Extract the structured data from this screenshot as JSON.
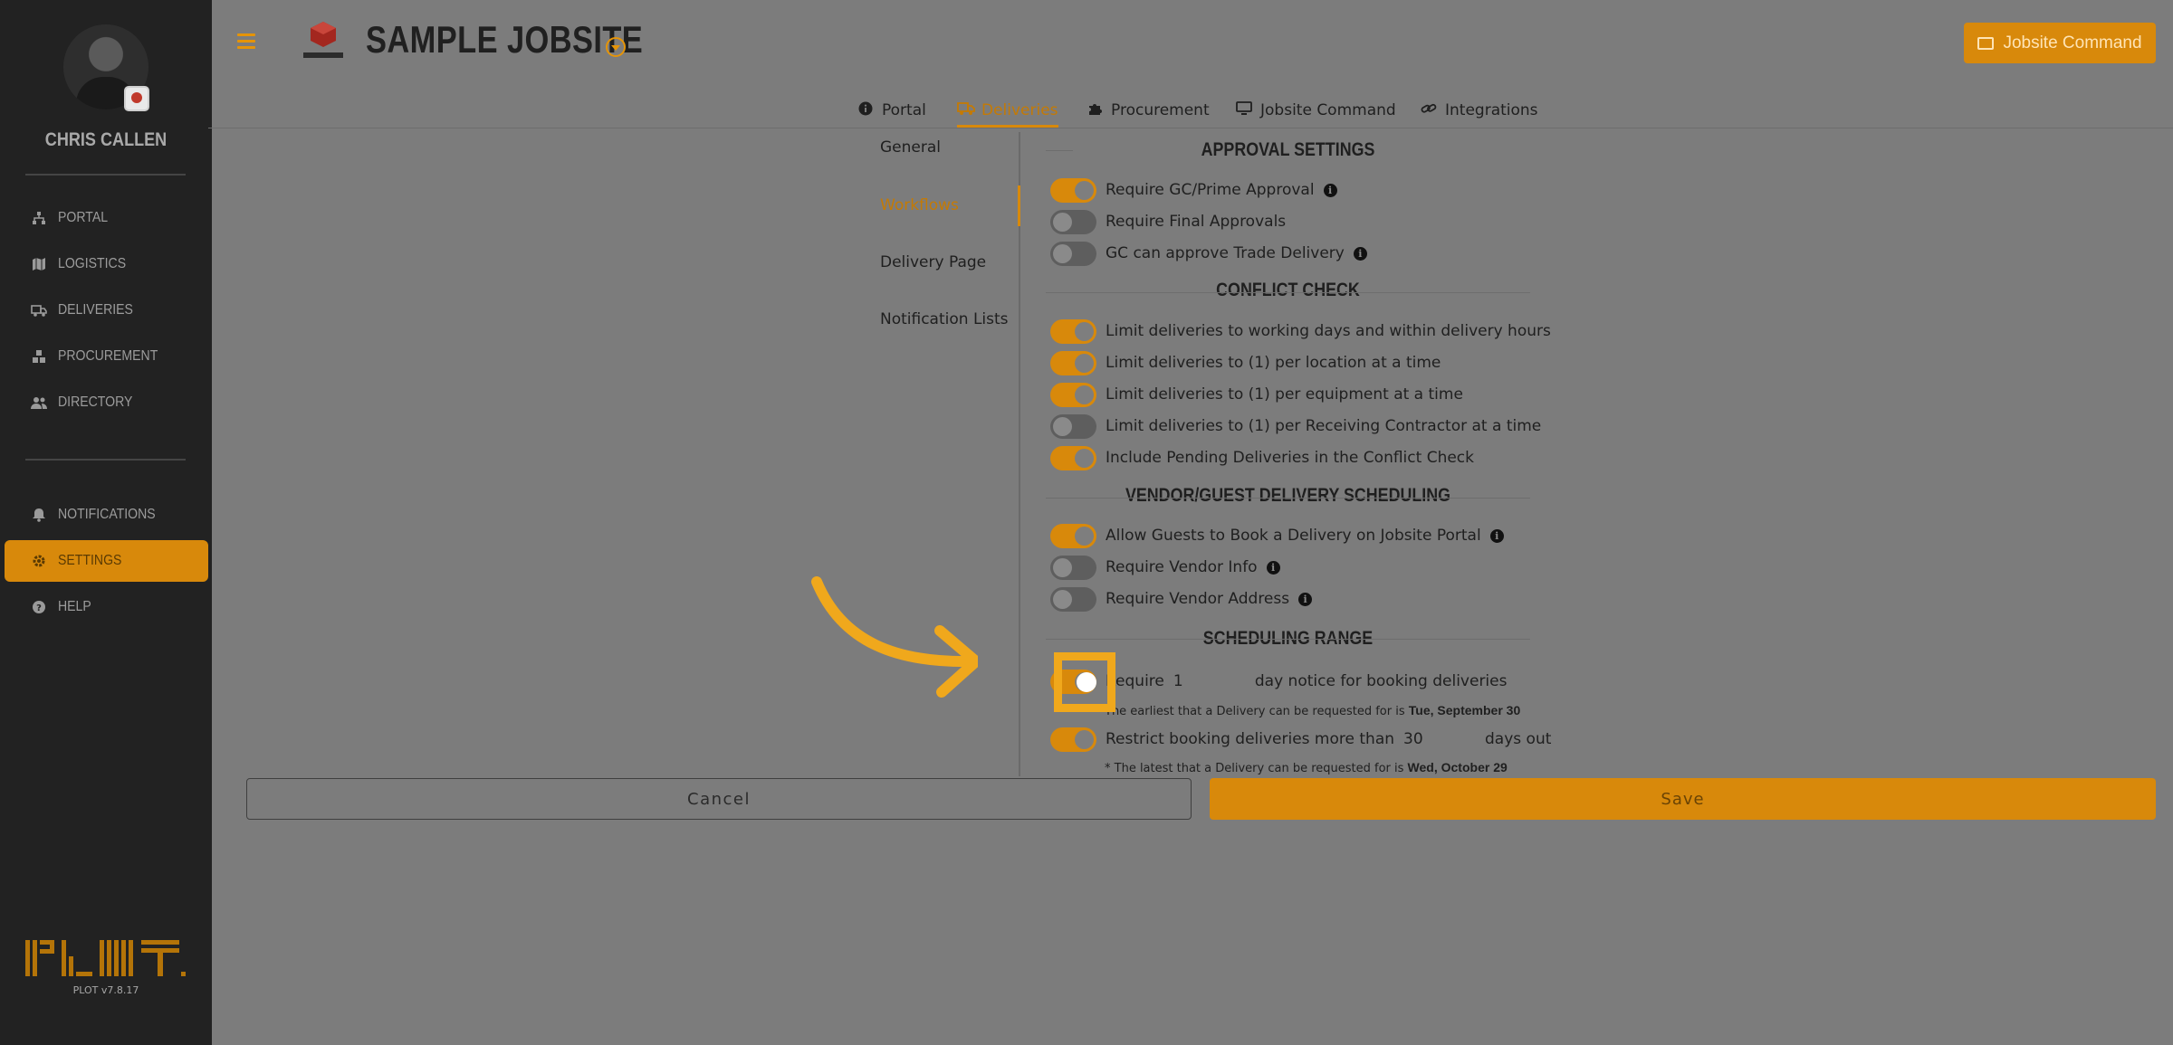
{
  "user": {
    "name": "CHRIS CALLEN"
  },
  "sidebar": {
    "items": [
      {
        "label": "PORTAL",
        "icon": "sitemap-icon"
      },
      {
        "label": "LOGISTICS",
        "icon": "map-icon"
      },
      {
        "label": "DELIVERIES",
        "icon": "truck-icon"
      },
      {
        "label": "PROCUREMENT",
        "icon": "cubes-icon"
      },
      {
        "label": "DIRECTORY",
        "icon": "users-icon"
      },
      {
        "label": "NOTIFICATIONS",
        "icon": "bell-icon"
      },
      {
        "label": "SETTINGS",
        "icon": "gear-icon",
        "active": true
      },
      {
        "label": "HELP",
        "icon": "question-icon"
      }
    ],
    "version": "PLOT v7.8.17"
  },
  "header": {
    "title": "SAMPLE JOBSITE",
    "command_button": "Jobsite Command"
  },
  "tabs": [
    {
      "label": "Portal",
      "icon": "info-circle-icon"
    },
    {
      "label": "Deliveries",
      "icon": "truck-icon",
      "active": true
    },
    {
      "label": "Procurement",
      "icon": "puzzle-icon"
    },
    {
      "label": "Jobsite Command",
      "icon": "monitor-icon"
    },
    {
      "label": "Integrations",
      "icon": "link-icon"
    }
  ],
  "subnav": [
    {
      "label": "General"
    },
    {
      "label": "Workflows",
      "active": true
    },
    {
      "label": "Delivery Page"
    },
    {
      "label": "Notification Lists"
    }
  ],
  "sections": {
    "approval": {
      "title": "APPROVAL SETTINGS",
      "rows": [
        {
          "label": "Require GC/Prime Approval",
          "on": true,
          "info": true
        },
        {
          "label": "Require Final Approvals",
          "on": false,
          "info": false
        },
        {
          "label": "GC can approve Trade Delivery",
          "on": false,
          "info": true
        }
      ]
    },
    "conflict": {
      "title": "CONFLICT CHECK",
      "rows": [
        {
          "label": "Limit deliveries to working days and within delivery hours",
          "on": true
        },
        {
          "label": "Limit deliveries to (1) per location at a time",
          "on": true
        },
        {
          "label": "Limit deliveries to (1) per equipment at a time",
          "on": true
        },
        {
          "label": "Limit deliveries to (1) per Receiving Contractor at a time",
          "on": false
        },
        {
          "label": "Include Pending Deliveries in the Conflict Check",
          "on": true
        }
      ]
    },
    "vendor": {
      "title": "VENDOR/GUEST DELIVERY SCHEDULING",
      "rows": [
        {
          "label": "Allow Guests to Book a Delivery on Jobsite Portal",
          "on": true,
          "info": true
        },
        {
          "label": "Require Vendor Info",
          "on": false,
          "info": true
        },
        {
          "label": "Require Vendor Address",
          "on": false,
          "info": true
        }
      ]
    },
    "scheduling": {
      "title": "SCHEDULING RANGE",
      "notice": {
        "prefix": "Require",
        "value": "1",
        "suffix": "day notice for booking deliveries",
        "on": true
      },
      "notice_note": {
        "text": "The earliest that a Delivery can be requested for is",
        "date": "Tue, September 30"
      },
      "restrict": {
        "prefix": "Restrict booking deliveries more than",
        "value": "30",
        "suffix": "days out",
        "on": true
      },
      "restrict_note": {
        "text": "* The latest that a Delivery can be requested for is",
        "date": "Wed, October 29"
      }
    }
  },
  "footer": {
    "cancel": "Cancel",
    "save": "Save"
  },
  "colors": {
    "accent": "#d8890b",
    "sidebar": "#222222",
    "overlay": "#7c7c7c",
    "highlight": "#f0a81c"
  }
}
